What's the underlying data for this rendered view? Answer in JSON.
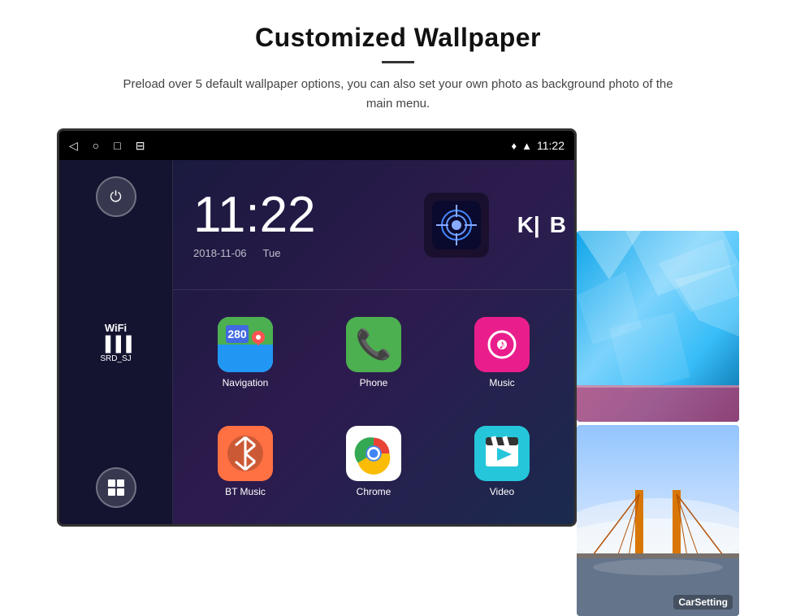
{
  "header": {
    "title": "Customized Wallpaper",
    "subtitle": "Preload over 5 default wallpaper options, you can also set your own photo as background photo of the main menu."
  },
  "device": {
    "status_bar": {
      "time": "11:22",
      "nav_icons": [
        "◁",
        "○",
        "□",
        "⊟"
      ],
      "status_icons": [
        "♦",
        "▲"
      ]
    },
    "clock": {
      "time": "11:22",
      "date": "2018-11-06",
      "day": "Tue"
    },
    "wifi": {
      "label": "WiFi",
      "ssid": "SRD_SJ"
    },
    "apps": [
      {
        "name": "Navigation",
        "type": "navigation"
      },
      {
        "name": "Phone",
        "type": "phone"
      },
      {
        "name": "Music",
        "type": "music"
      },
      {
        "name": "BT Music",
        "type": "bt"
      },
      {
        "name": "Chrome",
        "type": "chrome"
      },
      {
        "name": "Video",
        "type": "video"
      }
    ]
  },
  "wallpapers": [
    {
      "label": "",
      "type": "ice"
    },
    {
      "label": "CarSetting",
      "type": "bridge"
    }
  ]
}
